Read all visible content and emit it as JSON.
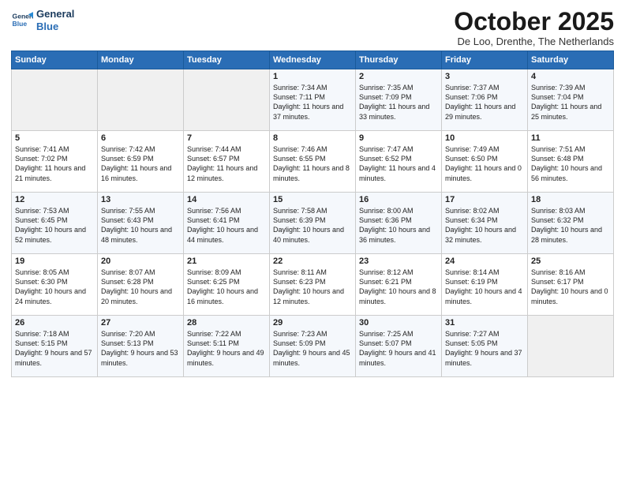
{
  "header": {
    "logo_line1": "General",
    "logo_line2": "Blue",
    "month_title": "October 2025",
    "subtitle": "De Loo, Drenthe, The Netherlands"
  },
  "days_of_week": [
    "Sunday",
    "Monday",
    "Tuesday",
    "Wednesday",
    "Thursday",
    "Friday",
    "Saturday"
  ],
  "weeks": [
    [
      {
        "day": "",
        "sunrise": "",
        "sunset": "",
        "daylight": ""
      },
      {
        "day": "",
        "sunrise": "",
        "sunset": "",
        "daylight": ""
      },
      {
        "day": "",
        "sunrise": "",
        "sunset": "",
        "daylight": ""
      },
      {
        "day": "1",
        "sunrise": "Sunrise: 7:34 AM",
        "sunset": "Sunset: 7:11 PM",
        "daylight": "Daylight: 11 hours and 37 minutes."
      },
      {
        "day": "2",
        "sunrise": "Sunrise: 7:35 AM",
        "sunset": "Sunset: 7:09 PM",
        "daylight": "Daylight: 11 hours and 33 minutes."
      },
      {
        "day": "3",
        "sunrise": "Sunrise: 7:37 AM",
        "sunset": "Sunset: 7:06 PM",
        "daylight": "Daylight: 11 hours and 29 minutes."
      },
      {
        "day": "4",
        "sunrise": "Sunrise: 7:39 AM",
        "sunset": "Sunset: 7:04 PM",
        "daylight": "Daylight: 11 hours and 25 minutes."
      }
    ],
    [
      {
        "day": "5",
        "sunrise": "Sunrise: 7:41 AM",
        "sunset": "Sunset: 7:02 PM",
        "daylight": "Daylight: 11 hours and 21 minutes."
      },
      {
        "day": "6",
        "sunrise": "Sunrise: 7:42 AM",
        "sunset": "Sunset: 6:59 PM",
        "daylight": "Daylight: 11 hours and 16 minutes."
      },
      {
        "day": "7",
        "sunrise": "Sunrise: 7:44 AM",
        "sunset": "Sunset: 6:57 PM",
        "daylight": "Daylight: 11 hours and 12 minutes."
      },
      {
        "day": "8",
        "sunrise": "Sunrise: 7:46 AM",
        "sunset": "Sunset: 6:55 PM",
        "daylight": "Daylight: 11 hours and 8 minutes."
      },
      {
        "day": "9",
        "sunrise": "Sunrise: 7:47 AM",
        "sunset": "Sunset: 6:52 PM",
        "daylight": "Daylight: 11 hours and 4 minutes."
      },
      {
        "day": "10",
        "sunrise": "Sunrise: 7:49 AM",
        "sunset": "Sunset: 6:50 PM",
        "daylight": "Daylight: 11 hours and 0 minutes."
      },
      {
        "day": "11",
        "sunrise": "Sunrise: 7:51 AM",
        "sunset": "Sunset: 6:48 PM",
        "daylight": "Daylight: 10 hours and 56 minutes."
      }
    ],
    [
      {
        "day": "12",
        "sunrise": "Sunrise: 7:53 AM",
        "sunset": "Sunset: 6:45 PM",
        "daylight": "Daylight: 10 hours and 52 minutes."
      },
      {
        "day": "13",
        "sunrise": "Sunrise: 7:55 AM",
        "sunset": "Sunset: 6:43 PM",
        "daylight": "Daylight: 10 hours and 48 minutes."
      },
      {
        "day": "14",
        "sunrise": "Sunrise: 7:56 AM",
        "sunset": "Sunset: 6:41 PM",
        "daylight": "Daylight: 10 hours and 44 minutes."
      },
      {
        "day": "15",
        "sunrise": "Sunrise: 7:58 AM",
        "sunset": "Sunset: 6:39 PM",
        "daylight": "Daylight: 10 hours and 40 minutes."
      },
      {
        "day": "16",
        "sunrise": "Sunrise: 8:00 AM",
        "sunset": "Sunset: 6:36 PM",
        "daylight": "Daylight: 10 hours and 36 minutes."
      },
      {
        "day": "17",
        "sunrise": "Sunrise: 8:02 AM",
        "sunset": "Sunset: 6:34 PM",
        "daylight": "Daylight: 10 hours and 32 minutes."
      },
      {
        "day": "18",
        "sunrise": "Sunrise: 8:03 AM",
        "sunset": "Sunset: 6:32 PM",
        "daylight": "Daylight: 10 hours and 28 minutes."
      }
    ],
    [
      {
        "day": "19",
        "sunrise": "Sunrise: 8:05 AM",
        "sunset": "Sunset: 6:30 PM",
        "daylight": "Daylight: 10 hours and 24 minutes."
      },
      {
        "day": "20",
        "sunrise": "Sunrise: 8:07 AM",
        "sunset": "Sunset: 6:28 PM",
        "daylight": "Daylight: 10 hours and 20 minutes."
      },
      {
        "day": "21",
        "sunrise": "Sunrise: 8:09 AM",
        "sunset": "Sunset: 6:25 PM",
        "daylight": "Daylight: 10 hours and 16 minutes."
      },
      {
        "day": "22",
        "sunrise": "Sunrise: 8:11 AM",
        "sunset": "Sunset: 6:23 PM",
        "daylight": "Daylight: 10 hours and 12 minutes."
      },
      {
        "day": "23",
        "sunrise": "Sunrise: 8:12 AM",
        "sunset": "Sunset: 6:21 PM",
        "daylight": "Daylight: 10 hours and 8 minutes."
      },
      {
        "day": "24",
        "sunrise": "Sunrise: 8:14 AM",
        "sunset": "Sunset: 6:19 PM",
        "daylight": "Daylight: 10 hours and 4 minutes."
      },
      {
        "day": "25",
        "sunrise": "Sunrise: 8:16 AM",
        "sunset": "Sunset: 6:17 PM",
        "daylight": "Daylight: 10 hours and 0 minutes."
      }
    ],
    [
      {
        "day": "26",
        "sunrise": "Sunrise: 7:18 AM",
        "sunset": "Sunset: 5:15 PM",
        "daylight": "Daylight: 9 hours and 57 minutes."
      },
      {
        "day": "27",
        "sunrise": "Sunrise: 7:20 AM",
        "sunset": "Sunset: 5:13 PM",
        "daylight": "Daylight: 9 hours and 53 minutes."
      },
      {
        "day": "28",
        "sunrise": "Sunrise: 7:22 AM",
        "sunset": "Sunset: 5:11 PM",
        "daylight": "Daylight: 9 hours and 49 minutes."
      },
      {
        "day": "29",
        "sunrise": "Sunrise: 7:23 AM",
        "sunset": "Sunset: 5:09 PM",
        "daylight": "Daylight: 9 hours and 45 minutes."
      },
      {
        "day": "30",
        "sunrise": "Sunrise: 7:25 AM",
        "sunset": "Sunset: 5:07 PM",
        "daylight": "Daylight: 9 hours and 41 minutes."
      },
      {
        "day": "31",
        "sunrise": "Sunrise: 7:27 AM",
        "sunset": "Sunset: 5:05 PM",
        "daylight": "Daylight: 9 hours and 37 minutes."
      },
      {
        "day": "",
        "sunrise": "",
        "sunset": "",
        "daylight": ""
      }
    ]
  ]
}
